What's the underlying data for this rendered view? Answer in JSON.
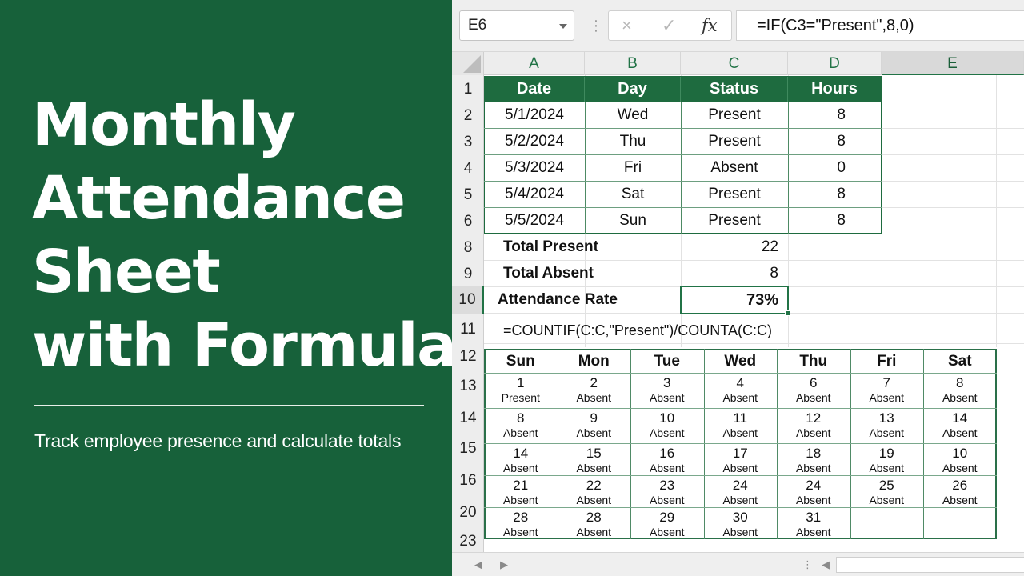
{
  "left_panel": {
    "title_lines": [
      "Monthly",
      "Attendance",
      "Sheet",
      "with Formulas"
    ],
    "subtitle": "Track employee presence and calculate totals",
    "background_color": "#17613a"
  },
  "formula_bar": {
    "name_box": "E6",
    "cancel_icon": "×",
    "enter_icon": "✓",
    "fx_label": "fx",
    "formula": "=IF(C3=\"Present\",8,0)"
  },
  "columns": [
    "A",
    "B",
    "C",
    "D",
    "E"
  ],
  "active_column": "E",
  "row_numbers": [
    "1",
    "2",
    "3",
    "4",
    "5",
    "6",
    "8",
    "9",
    "10",
    "11",
    "12",
    "13",
    "14",
    "15",
    "16",
    "20",
    "23"
  ],
  "active_row": "10",
  "table": {
    "headers": [
      "Date",
      "Day",
      "Status",
      "Hours"
    ],
    "rows": [
      [
        "5/1/2024",
        "Wed",
        "Present",
        "8"
      ],
      [
        "5/2/2024",
        "Thu",
        "Present",
        "8"
      ],
      [
        "5/3/2024",
        "Fri",
        "Absent",
        "0"
      ],
      [
        "5/4/2024",
        "Sat",
        "Present",
        "8"
      ],
      [
        "5/5/2024",
        "Sun",
        "Present",
        "8"
      ]
    ]
  },
  "summary": [
    {
      "label": "Total Present",
      "value": "22"
    },
    {
      "label": "Total Absent",
      "value": "8"
    },
    {
      "label": "Attendance Rate",
      "value": "73%"
    }
  ],
  "rate_formula": "=COUNTIF(C:C,\"Present\")/COUNTA(C:C)",
  "calendar": {
    "days": [
      "Sun",
      "Mon",
      "Tue",
      "Wed",
      "Thu",
      "Fri",
      "Sat"
    ],
    "weeks": [
      [
        {
          "num": "1",
          "status": "Present"
        },
        {
          "num": "2",
          "status": "Absent"
        },
        {
          "num": "3",
          "status": "Absent"
        },
        {
          "num": "4",
          "status": "Absent"
        },
        {
          "num": "6",
          "status": "Absent"
        },
        {
          "num": "7",
          "status": "Absent"
        },
        {
          "num": "8",
          "status": "Absent"
        }
      ],
      [
        {
          "num": "8",
          "status": "Absent"
        },
        {
          "num": "9",
          "status": "Absent"
        },
        {
          "num": "10",
          "status": "Absent"
        },
        {
          "num": "11",
          "status": "Absent"
        },
        {
          "num": "12",
          "status": "Absent"
        },
        {
          "num": "13",
          "status": "Absent"
        },
        {
          "num": "14",
          "status": "Absent"
        }
      ],
      [
        {
          "num": "14",
          "status": "Absent"
        },
        {
          "num": "15",
          "status": "Absent"
        },
        {
          "num": "16",
          "status": "Absent"
        },
        {
          "num": "17",
          "status": "Absent"
        },
        {
          "num": "18",
          "status": "Absent"
        },
        {
          "num": "19",
          "status": "Absent"
        },
        {
          "num": "10",
          "status": "Absent"
        }
      ],
      [
        {
          "num": "21",
          "status": "Absent"
        },
        {
          "num": "22",
          "status": "Absent"
        },
        {
          "num": "23",
          "status": "Absent"
        },
        {
          "num": "24",
          "status": "Absent"
        },
        {
          "num": "24",
          "status": "Absent"
        },
        {
          "num": "25",
          "status": "Absent"
        },
        {
          "num": "26",
          "status": "Absent"
        }
      ],
      [
        {
          "num": "28",
          "status": "Absent"
        },
        {
          "num": "28",
          "status": "Absent"
        },
        {
          "num": "29",
          "status": "Absent"
        },
        {
          "num": "30",
          "status": "Absent"
        },
        {
          "num": "31",
          "status": "Absent"
        },
        null,
        null
      ]
    ]
  },
  "colors": {
    "excel_green": "#217346",
    "header_fill": "#1e6b3f"
  }
}
